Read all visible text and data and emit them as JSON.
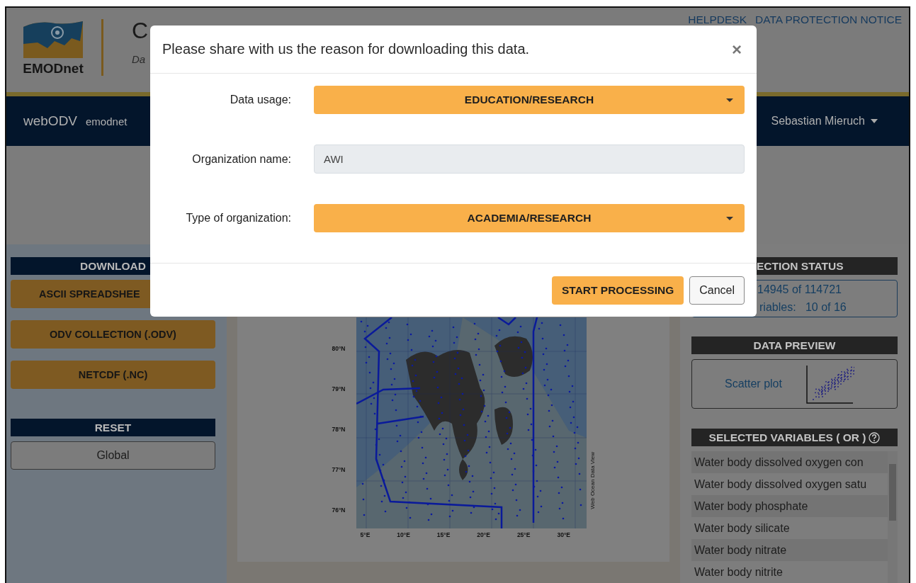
{
  "header": {
    "logo_text": "EMODnet",
    "title": "C",
    "subtitle": "Da",
    "links": [
      "HELPDESK",
      "DATA PROTECTION NOTICE"
    ]
  },
  "navbar": {
    "brand": "webODV",
    "dataset": "emodnet",
    "user": "Sebastian Mieruch"
  },
  "left_panel": {
    "download": {
      "title": "DOWNLOAD",
      "buttons": [
        "ASCII SPREADSHEE",
        "ODV COLLECTION (.ODV)",
        "NETCDF (.NC)"
      ]
    },
    "reset": {
      "title": "RESET",
      "buttons": [
        "Global"
      ]
    }
  },
  "map": {
    "lat_labels": [
      "80°N",
      "79°N",
      "78°N",
      "77°N",
      "76°N"
    ],
    "lon_labels": [
      "5°E",
      "10°E",
      "15°E",
      "20°E",
      "25°E",
      "30°E"
    ],
    "credit": "Web Ocean Data View"
  },
  "right_panel": {
    "collection_status": {
      "title": "ECTION STATUS",
      "lines": [
        "14945 of 114721",
        "riables:   10 of 16"
      ]
    },
    "data_preview": {
      "title": "DATA PREVIEW",
      "link": "Scatter plot"
    },
    "selected_variables": {
      "title": "SELECTED VARIABLES ( OR )",
      "items": [
        "Water body dissolved oxygen con",
        "Water body dissolved oxygen satu",
        "Water body phosphate",
        "Water body silicate",
        "Water body nitrate",
        "Water body nitrite"
      ]
    }
  },
  "modal": {
    "title": "Please share with us the reason for downloading this data.",
    "close": "×",
    "fields": [
      {
        "kind": "select",
        "label": "Data usage:",
        "value": "EDUCATION/RESEARCH",
        "disabled": false
      },
      {
        "kind": "input",
        "label": "Organization name:",
        "value": "AWI",
        "disabled": true
      },
      {
        "kind": "select",
        "label": "Type of organization:",
        "value": "ACADEMIA/RESEARCH",
        "disabled": false
      }
    ],
    "buttons": [
      {
        "kind": "primary",
        "label": "START PROCESSING"
      },
      {
        "kind": "secondary",
        "label": "Cancel"
      }
    ]
  }
}
